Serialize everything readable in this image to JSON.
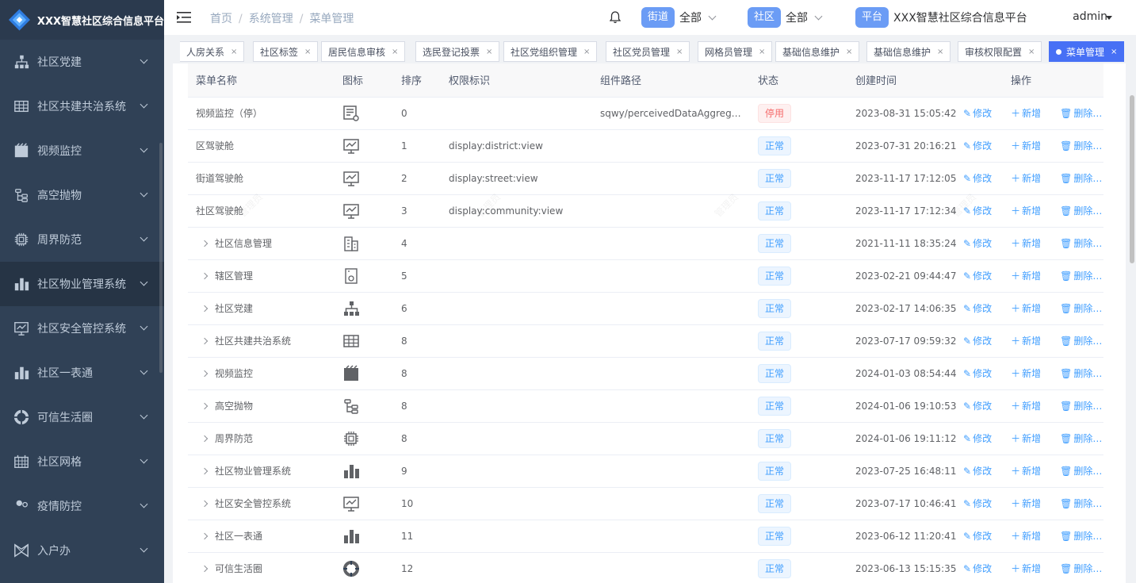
{
  "app": {
    "title": "XXX智慧社区综合信息平台"
  },
  "sidebar": {
    "items": [
      {
        "label": "社区党建",
        "icon": "org-tree-icon"
      },
      {
        "label": "社区共建共治系统",
        "icon": "table-icon"
      },
      {
        "label": "视频监控",
        "icon": "clapperboard-icon"
      },
      {
        "label": "高空抛物",
        "icon": "branch-icon"
      },
      {
        "label": "周界防范",
        "icon": "chip-icon"
      },
      {
        "label": "社区物业管理系统",
        "icon": "bar-chart-icon"
      },
      {
        "label": "社区安全管控系统",
        "icon": "monitor-chart-icon"
      },
      {
        "label": "社区一表通",
        "icon": "bar-chart-icon"
      },
      {
        "label": "可信生活圈",
        "icon": "ring-icon"
      },
      {
        "label": "社区网格",
        "icon": "grid-icon"
      },
      {
        "label": "疫情防控",
        "icon": "people-icon"
      },
      {
        "label": "入户办",
        "icon": "bowtie-icon"
      }
    ]
  },
  "header": {
    "breadcrumb": [
      "首页",
      "系统管理",
      "菜单管理"
    ],
    "street": {
      "tag": "街道",
      "value": "全部"
    },
    "community": {
      "tag": "社区",
      "value": "全部"
    },
    "platform": {
      "tag": "平台",
      "value": "XXX智慧社区综合信息平台"
    },
    "user": "admin"
  },
  "tags": [
    "人房关系",
    "社区标签",
    "居民信息审核",
    "选民登记投票",
    "社区党组织管理",
    "社区党员管理",
    "网格员管理",
    "基础信息维护",
    "基础信息维护",
    "审核权限配置",
    "菜单管理"
  ],
  "table": {
    "headers": [
      "菜单名称",
      "图标",
      "排序",
      "权限标识",
      "组件路径",
      "状态",
      "创建时间",
      "操作"
    ],
    "actions": {
      "edit": "修改",
      "add": "新增",
      "delete": "删除"
    },
    "rows": [
      {
        "name": "视频监控（停）",
        "expand": false,
        "icon": "monitor-gear-icon",
        "order": "0",
        "perm": "",
        "path": "sqwy/perceivedDataAggreg…",
        "status": "停用",
        "status_type": "off",
        "created": "2023-08-31 15:05:42"
      },
      {
        "name": "区驾驶舱",
        "expand": false,
        "icon": "monitor-chart-icon",
        "order": "1",
        "perm": "display:district:view",
        "path": "",
        "status": "正常",
        "status_type": "ok",
        "created": "2023-07-31 20:16:21"
      },
      {
        "name": "街道驾驶舱",
        "expand": false,
        "icon": "monitor-chart-icon",
        "order": "2",
        "perm": "display:street:view",
        "path": "",
        "status": "正常",
        "status_type": "ok",
        "created": "2023-11-17 17:12:05"
      },
      {
        "name": "社区驾驶舱",
        "expand": false,
        "icon": "monitor-chart-icon",
        "order": "3",
        "perm": "display:community:view",
        "path": "",
        "status": "正常",
        "status_type": "ok",
        "created": "2023-11-17 17:12:34"
      },
      {
        "name": "社区信息管理",
        "expand": true,
        "icon": "building-icon",
        "order": "4",
        "perm": "",
        "path": "",
        "status": "正常",
        "status_type": "ok",
        "created": "2021-11-11 18:35:24"
      },
      {
        "name": "辖区管理",
        "expand": true,
        "icon": "device-icon",
        "order": "5",
        "perm": "",
        "path": "",
        "status": "正常",
        "status_type": "ok",
        "created": "2023-02-21 09:44:47"
      },
      {
        "name": "社区党建",
        "expand": true,
        "icon": "org-tree-icon",
        "order": "6",
        "perm": "",
        "path": "",
        "status": "正常",
        "status_type": "ok",
        "created": "2023-02-17 14:06:35"
      },
      {
        "name": "社区共建共治系统",
        "expand": true,
        "icon": "table-icon",
        "order": "8",
        "perm": "",
        "path": "",
        "status": "正常",
        "status_type": "ok",
        "created": "2023-07-17 09:59:32"
      },
      {
        "name": "视频监控",
        "expand": true,
        "icon": "clapperboard-icon",
        "order": "8",
        "perm": "",
        "path": "",
        "status": "正常",
        "status_type": "ok",
        "created": "2024-01-03 08:54:44"
      },
      {
        "name": "高空抛物",
        "expand": true,
        "icon": "branch-icon",
        "order": "8",
        "perm": "",
        "path": "",
        "status": "正常",
        "status_type": "ok",
        "created": "2024-01-06 19:10:53"
      },
      {
        "name": "周界防范",
        "expand": true,
        "icon": "chip-icon",
        "order": "8",
        "perm": "",
        "path": "",
        "status": "正常",
        "status_type": "ok",
        "created": "2024-01-06 19:11:12"
      },
      {
        "name": "社区物业管理系统",
        "expand": true,
        "icon": "bar-chart-icon",
        "order": "9",
        "perm": "",
        "path": "",
        "status": "正常",
        "status_type": "ok",
        "created": "2023-07-25 16:48:11"
      },
      {
        "name": "社区安全管控系统",
        "expand": true,
        "icon": "monitor-chart-icon",
        "order": "10",
        "perm": "",
        "path": "",
        "status": "正常",
        "status_type": "ok",
        "created": "2023-07-17 10:46:41"
      },
      {
        "name": "社区一表通",
        "expand": true,
        "icon": "bar-chart-icon",
        "order": "11",
        "perm": "",
        "path": "",
        "status": "正常",
        "status_type": "ok",
        "created": "2023-06-12 11:20:41"
      },
      {
        "name": "可信生活圈",
        "expand": true,
        "icon": "ring-icon",
        "order": "12",
        "perm": "",
        "path": "",
        "status": "正常",
        "status_type": "ok",
        "created": "2023-06-13 15:15:35"
      }
    ]
  }
}
